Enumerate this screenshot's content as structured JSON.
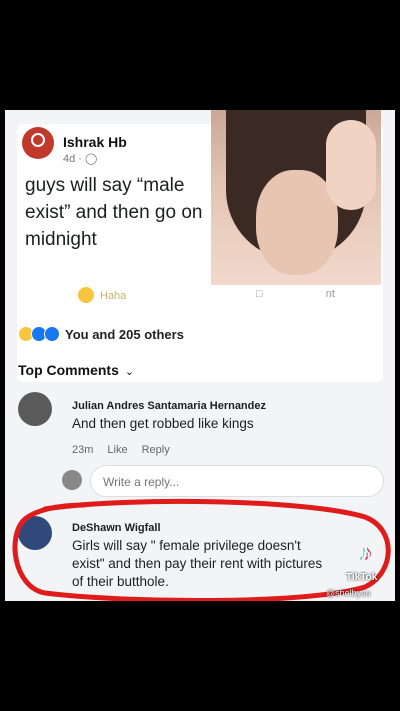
{
  "post": {
    "author": "Ishrak Hb",
    "time": "4d · ",
    "globe_icon": "globe-icon",
    "text_lines": [
      "guys will say “male",
      "exist” and then go on",
      "midnight"
    ]
  },
  "actions": {
    "haha_label": "Haha",
    "comment_label": "nt"
  },
  "reactions": {
    "summary": "You and 205 others",
    "colors": [
      "#f7c63c",
      "#1877f2",
      "#1877f2"
    ]
  },
  "top_comments": {
    "label": "Top Comments",
    "chevron": "⌄"
  },
  "comments": [
    {
      "name": "Julian Andres Santamaria Hernandez",
      "text": "And then get robbed like kings",
      "time": "23m",
      "like": "Like",
      "reply": "Reply"
    },
    {
      "name": "DeShawn Wigfall",
      "text_lines": [
        "Girls will say \" female privilege doesn't",
        "exist\" and then pay their rent with pictures",
        "of their butthole."
      ]
    }
  ],
  "reply": {
    "placeholder": "Write a reply..."
  },
  "watermark": {
    "logo": "♪",
    "label": "TikTok",
    "handle": "@shelbysu"
  }
}
